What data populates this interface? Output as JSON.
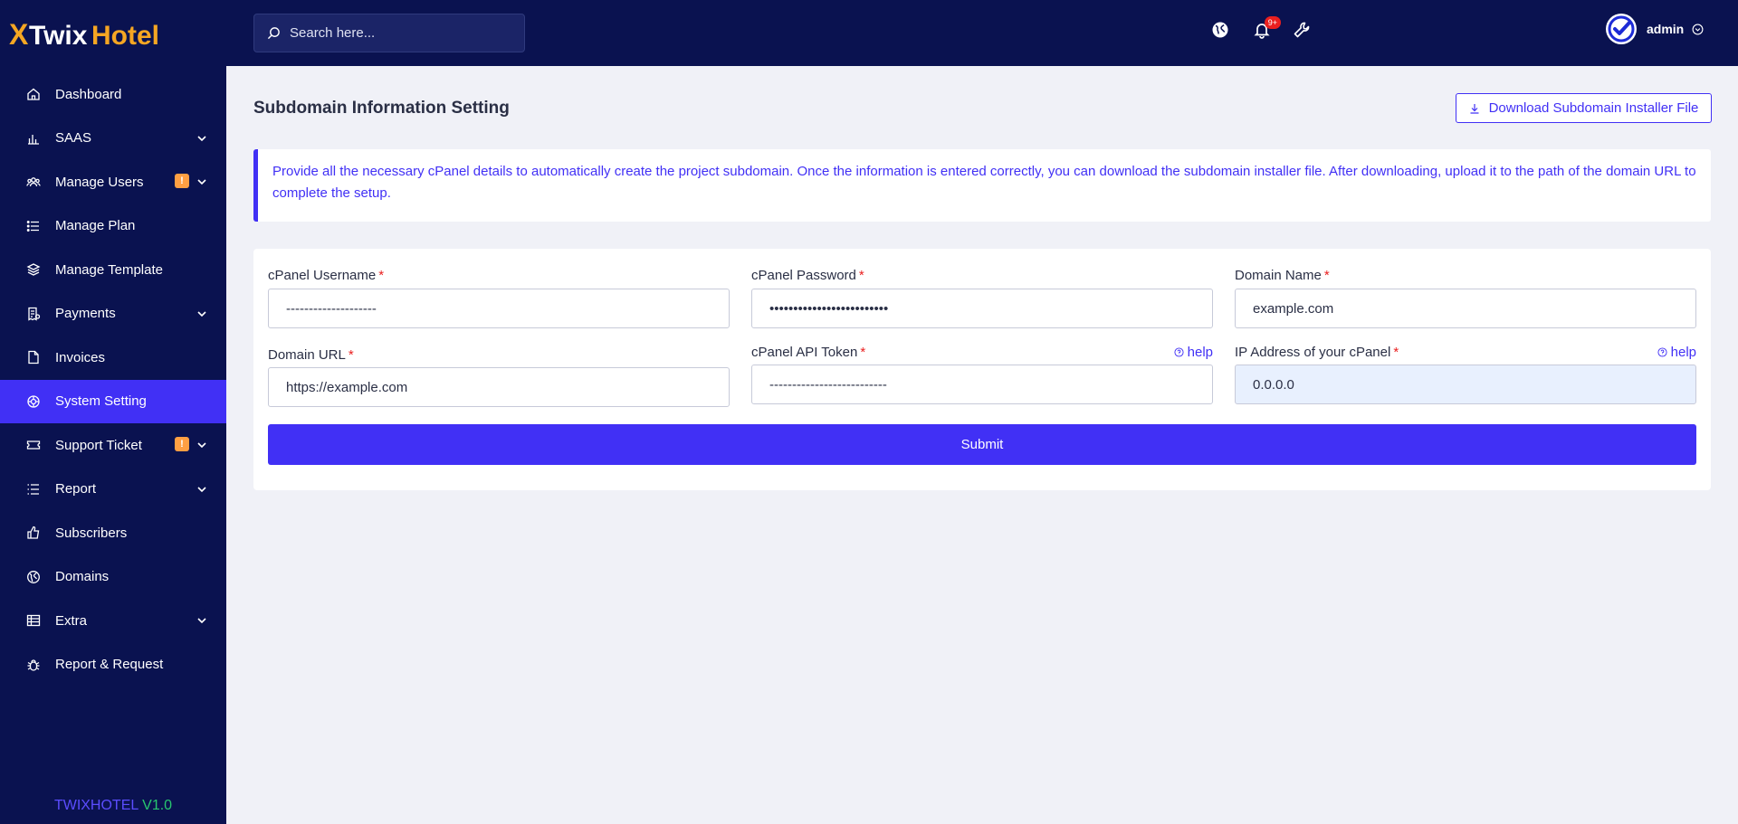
{
  "brand": {
    "logo_x": "X",
    "logo_part1": "Twix",
    "logo_part2": "Hotel",
    "version_part1": "TWIXHOTEL",
    "version_part2": "V1.0"
  },
  "sidebar": {
    "items": [
      {
        "label": "Dashboard",
        "icon": "home-icon"
      },
      {
        "label": "SAAS",
        "icon": "bar-chart-icon",
        "has_chevron": true
      },
      {
        "label": "Manage Users",
        "icon": "users-icon",
        "badge": "!",
        "has_chevron": true
      },
      {
        "label": "Manage Plan",
        "icon": "list-icon"
      },
      {
        "label": "Manage Template",
        "icon": "layers-icon"
      },
      {
        "label": "Payments",
        "icon": "receipt-icon",
        "has_chevron": true
      },
      {
        "label": "Invoices",
        "icon": "file-icon"
      },
      {
        "label": "System Setting",
        "icon": "settings-icon",
        "active": true
      },
      {
        "label": "Support Ticket",
        "icon": "ticket-icon",
        "badge": "!",
        "has_chevron": true
      },
      {
        "label": "Report",
        "icon": "report-icon",
        "has_chevron": true
      },
      {
        "label": "Subscribers",
        "icon": "thumbs-up-icon"
      },
      {
        "label": "Domains",
        "icon": "globe-icon"
      },
      {
        "label": "Extra",
        "icon": "table-icon",
        "has_chevron": true
      },
      {
        "label": "Report & Request",
        "icon": "bug-icon"
      }
    ]
  },
  "topbar": {
    "search_placeholder": "Search here...",
    "notification_count": "9+",
    "user_name": "admin"
  },
  "page": {
    "title": "Subdomain Information Setting",
    "download_label": "Download Subdomain Installer File",
    "alert_text": "Provide all the necessary cPanel details to automatically create the project subdomain. Once the information is entered correctly, you can download the subdomain installer file. After downloading, upload it to the path of the domain URL to complete the setup."
  },
  "form": {
    "cpanel_username": {
      "label": "cPanel Username",
      "placeholder": "--------------------"
    },
    "cpanel_password": {
      "label": "cPanel Password",
      "value": "•••••••••••••••••••••••••"
    },
    "domain_name": {
      "label": "Domain Name",
      "placeholder": "example.com"
    },
    "domain_url": {
      "label": "Domain URL",
      "placeholder": "https://example.com"
    },
    "cpanel_api_token": {
      "label": "cPanel API Token",
      "placeholder": "--------------------------",
      "help": "help"
    },
    "ip_address": {
      "label": "IP Address of your cPanel",
      "value": "0.0.0.0",
      "help": "help"
    },
    "submit_label": "Submit"
  },
  "colors": {
    "primary": "#4130f5",
    "sidebar_bg": "#0a1250",
    "badge": "#ff9f43",
    "required": "#ea1f1f",
    "accent_gold": "#f5a623"
  }
}
